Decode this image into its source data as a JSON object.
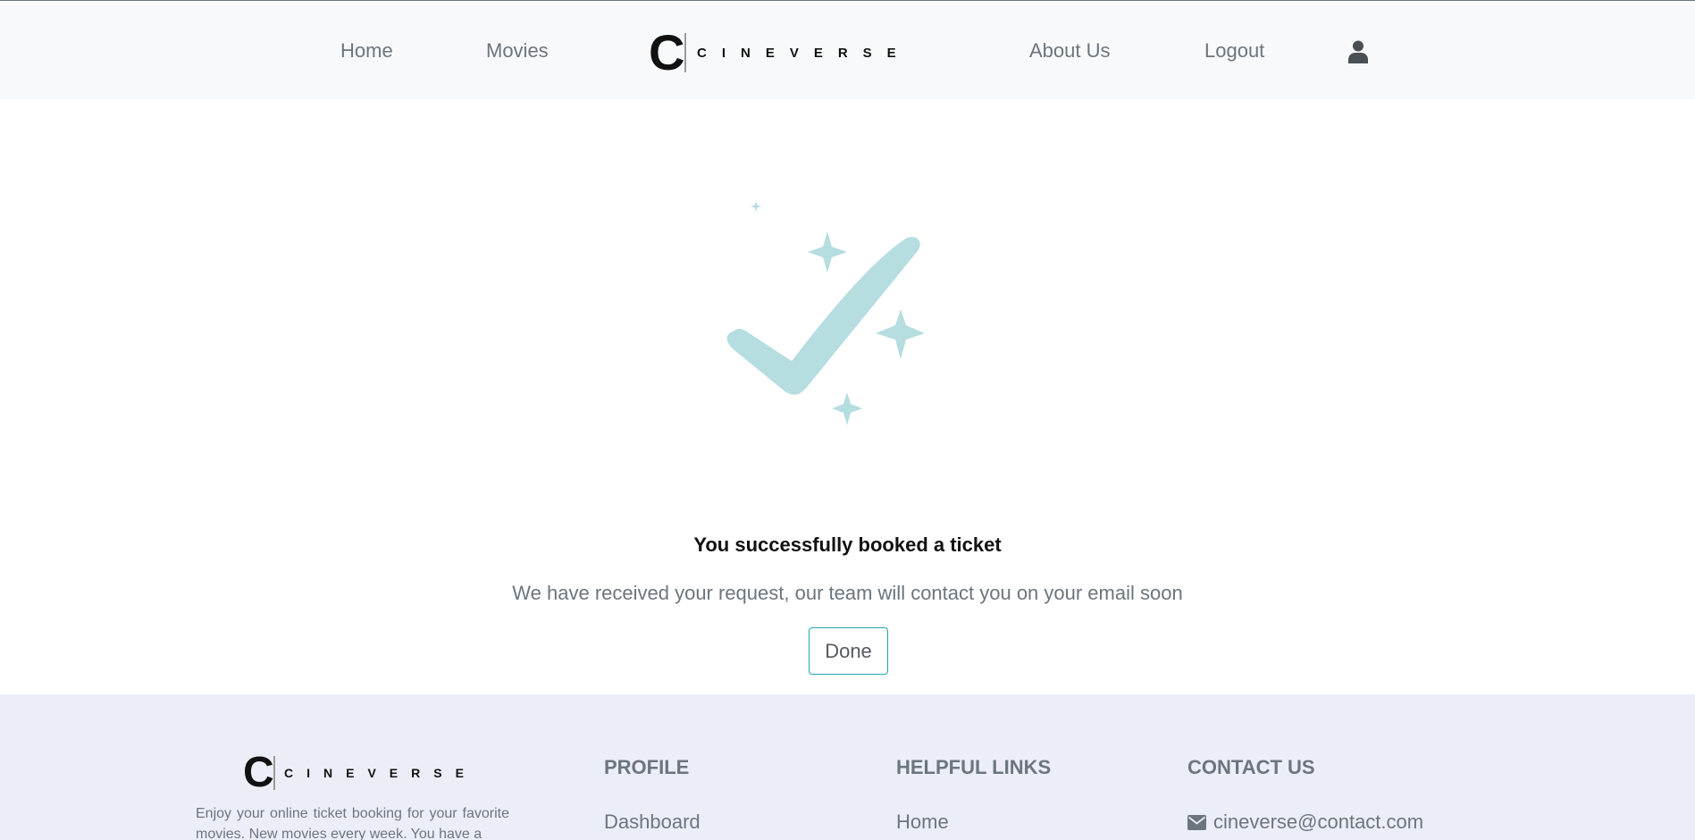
{
  "header": {
    "nav": {
      "home": "Home",
      "movies": "Movies",
      "about": "About Us",
      "logout": "Logout"
    },
    "logo": {
      "letter": "C",
      "wordmark": "CINEVERSE"
    },
    "user_icon": "user-icon"
  },
  "main": {
    "icon": "sparkle-check-icon",
    "title": "You successfully booked a ticket",
    "message": "We have received your request, our team will contact you on your email soon",
    "done_label": "Done"
  },
  "footer": {
    "logo": {
      "letter": "C",
      "wordmark": "CINEVERSE"
    },
    "about_text": "Enjoy your online ticket booking for your favorite movies. New movies every week. You have a",
    "profile": {
      "heading": "PROFILE",
      "links": [
        "Dashboard"
      ]
    },
    "helpful_links": {
      "heading": "HELPFUL LINKS",
      "links": [
        "Home"
      ]
    },
    "contact": {
      "heading": "CONTACT US",
      "email": "cineverse@contact.com",
      "email_icon": "envelope-icon"
    }
  },
  "colors": {
    "accent": "#20a8a8",
    "check": "#b6dde0",
    "header_bg": "#f8f9fa",
    "footer_bg": "#eceef7",
    "muted_text": "#6c757d"
  }
}
